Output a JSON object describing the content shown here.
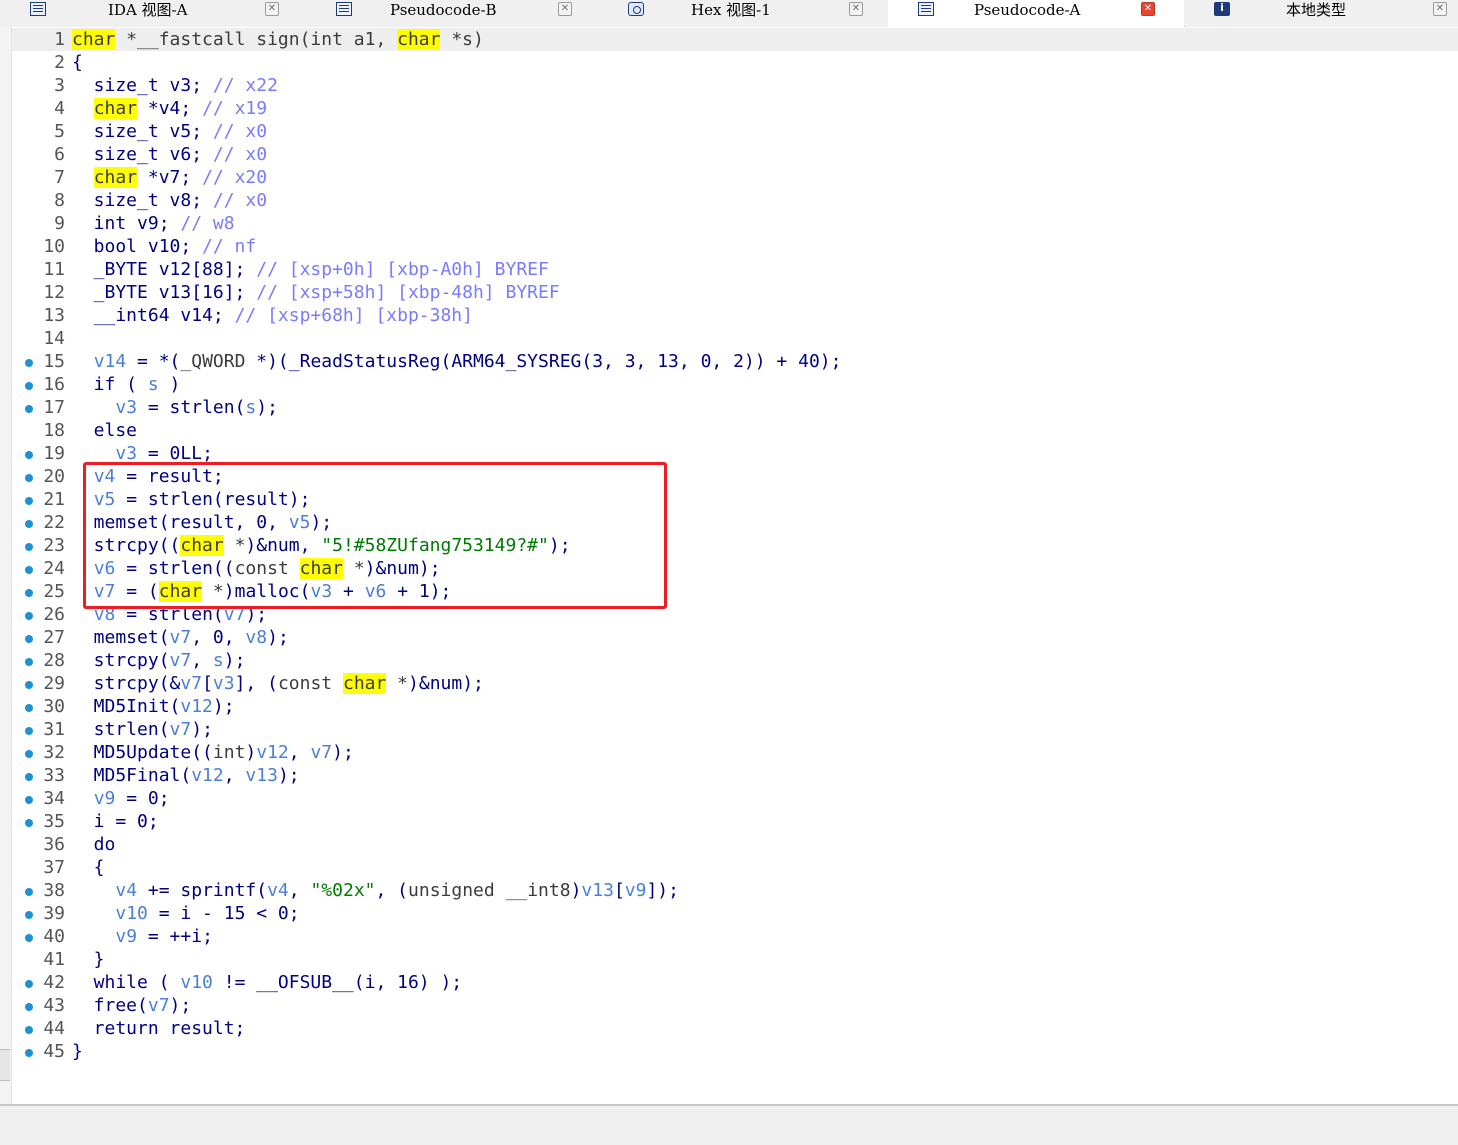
{
  "tabs": [
    {
      "label": "IDA 视图-A",
      "icon": "document-icon",
      "active": false
    },
    {
      "label": "Pseudocode-B",
      "icon": "document-icon",
      "active": false
    },
    {
      "label": "Hex 视图-1",
      "icon": "hex-view-icon",
      "active": false
    },
    {
      "label": "Pseudocode-A",
      "icon": "document-icon",
      "active": true
    },
    {
      "label": "本地类型",
      "icon": "info-icon",
      "active": false
    }
  ],
  "colors": {
    "keyword_highlight": "#ffff00",
    "variable": "#4a7fd6",
    "string": "#007a00",
    "comment": "#7a7aff",
    "breakpoint_dot": "#1e90d8",
    "annotation_box": "#ee1c24"
  },
  "annotation": {
    "shape": "red rectangle",
    "first_line": 20,
    "last_line": 25
  },
  "code": [
    {
      "n": "1",
      "dot": false,
      "tokens": [
        [
          "hl",
          "char"
        ],
        [
          "kw",
          " *__fastcall sign(int a1, "
        ],
        [
          "hl",
          "char"
        ],
        [
          "kw",
          " *s)"
        ]
      ]
    },
    {
      "n": "2",
      "dot": false,
      "tokens": [
        [
          "p",
          "{"
        ]
      ]
    },
    {
      "n": "3",
      "dot": false,
      "tokens": [
        [
          "p",
          "  size_t v3; "
        ],
        [
          "cm",
          "// x22"
        ]
      ]
    },
    {
      "n": "4",
      "dot": false,
      "tokens": [
        [
          "p",
          "  "
        ],
        [
          "hl",
          "char"
        ],
        [
          "p",
          " *v4; "
        ],
        [
          "cm",
          "// x19"
        ]
      ]
    },
    {
      "n": "5",
      "dot": false,
      "tokens": [
        [
          "p",
          "  size_t v5; "
        ],
        [
          "cm",
          "// x0"
        ]
      ]
    },
    {
      "n": "6",
      "dot": false,
      "tokens": [
        [
          "p",
          "  size_t v6; "
        ],
        [
          "cm",
          "// x0"
        ]
      ]
    },
    {
      "n": "7",
      "dot": false,
      "tokens": [
        [
          "p",
          "  "
        ],
        [
          "hl",
          "char"
        ],
        [
          "p",
          " *v7; "
        ],
        [
          "cm",
          "// x20"
        ]
      ]
    },
    {
      "n": "8",
      "dot": false,
      "tokens": [
        [
          "p",
          "  size_t v8; "
        ],
        [
          "cm",
          "// x0"
        ]
      ]
    },
    {
      "n": "9",
      "dot": false,
      "tokens": [
        [
          "p",
          "  int v9; "
        ],
        [
          "cm",
          "// w8"
        ]
      ]
    },
    {
      "n": "10",
      "dot": false,
      "tokens": [
        [
          "p",
          "  bool v10; "
        ],
        [
          "cm",
          "// nf"
        ]
      ]
    },
    {
      "n": "11",
      "dot": false,
      "tokens": [
        [
          "p",
          "  _BYTE v12[88]; "
        ],
        [
          "cm",
          "// [xsp+0h] [xbp-A0h] BYREF"
        ]
      ]
    },
    {
      "n": "12",
      "dot": false,
      "tokens": [
        [
          "p",
          "  _BYTE v13[16]; "
        ],
        [
          "cm",
          "// [xsp+58h] [xbp-48h] BYREF"
        ]
      ]
    },
    {
      "n": "13",
      "dot": false,
      "tokens": [
        [
          "p",
          "  __int64 v14; "
        ],
        [
          "cm",
          "// [xsp+68h] [xbp-38h]"
        ]
      ]
    },
    {
      "n": "14",
      "dot": false,
      "tokens": []
    },
    {
      "n": "15",
      "dot": true,
      "tokens": [
        [
          "p",
          "  "
        ],
        [
          "var",
          "v14"
        ],
        [
          "p",
          " = *("
        ],
        [
          "kw",
          "_QWORD"
        ],
        [
          "p",
          " *)(_ReadStatusReg(ARM64_SYSREG(3, 3, 13, 0, 2)) + 40);"
        ]
      ]
    },
    {
      "n": "16",
      "dot": true,
      "tokens": [
        [
          "p",
          "  if ( "
        ],
        [
          "var",
          "s"
        ],
        [
          "p",
          " )"
        ]
      ]
    },
    {
      "n": "17",
      "dot": true,
      "tokens": [
        [
          "p",
          "    "
        ],
        [
          "var",
          "v3"
        ],
        [
          "p",
          " = strlen("
        ],
        [
          "var",
          "s"
        ],
        [
          "p",
          ");"
        ]
      ]
    },
    {
      "n": "18",
      "dot": false,
      "tokens": [
        [
          "p",
          "  else"
        ]
      ]
    },
    {
      "n": "19",
      "dot": true,
      "tokens": [
        [
          "p",
          "    "
        ],
        [
          "var",
          "v3"
        ],
        [
          "p",
          " = 0LL;"
        ]
      ]
    },
    {
      "n": "20",
      "dot": true,
      "tokens": [
        [
          "p",
          "  "
        ],
        [
          "var",
          "v4"
        ],
        [
          "p",
          " = result;"
        ]
      ]
    },
    {
      "n": "21",
      "dot": true,
      "tokens": [
        [
          "p",
          "  "
        ],
        [
          "var",
          "v5"
        ],
        [
          "p",
          " = strlen(result);"
        ]
      ]
    },
    {
      "n": "22",
      "dot": true,
      "tokens": [
        [
          "p",
          "  memset(result, 0, "
        ],
        [
          "var",
          "v5"
        ],
        [
          "p",
          ");"
        ]
      ]
    },
    {
      "n": "23",
      "dot": true,
      "tokens": [
        [
          "p",
          "  strcpy(("
        ],
        [
          "hl",
          "char"
        ],
        [
          "kw",
          " *"
        ],
        [
          "p",
          ")&num, "
        ],
        [
          "str",
          "\"5!#58ZUfang753149?#\""
        ],
        [
          "p",
          ");"
        ]
      ]
    },
    {
      "n": "24",
      "dot": true,
      "tokens": [
        [
          "p",
          "  "
        ],
        [
          "var",
          "v6"
        ],
        [
          "p",
          " = strlen(("
        ],
        [
          "kw",
          "const "
        ],
        [
          "hl",
          "char"
        ],
        [
          "kw",
          " *"
        ],
        [
          "p",
          ")&num);"
        ]
      ]
    },
    {
      "n": "25",
      "dot": true,
      "tokens": [
        [
          "p",
          "  "
        ],
        [
          "var",
          "v7"
        ],
        [
          "p",
          " = ("
        ],
        [
          "hl",
          "char"
        ],
        [
          "kw",
          " *"
        ],
        [
          "p",
          ")malloc("
        ],
        [
          "var",
          "v3"
        ],
        [
          "p",
          " + "
        ],
        [
          "var",
          "v6"
        ],
        [
          "p",
          " + 1);"
        ]
      ]
    },
    {
      "n": "26",
      "dot": true,
      "tokens": [
        [
          "p",
          "  "
        ],
        [
          "var",
          "v8"
        ],
        [
          "p",
          " = strlen("
        ],
        [
          "var",
          "v7"
        ],
        [
          "p",
          ");"
        ]
      ]
    },
    {
      "n": "27",
      "dot": true,
      "tokens": [
        [
          "p",
          "  memset("
        ],
        [
          "var",
          "v7"
        ],
        [
          "p",
          ", 0, "
        ],
        [
          "var",
          "v8"
        ],
        [
          "p",
          ");"
        ]
      ]
    },
    {
      "n": "28",
      "dot": true,
      "tokens": [
        [
          "p",
          "  strcpy("
        ],
        [
          "var",
          "v7"
        ],
        [
          "p",
          ", "
        ],
        [
          "var",
          "s"
        ],
        [
          "p",
          ");"
        ]
      ]
    },
    {
      "n": "29",
      "dot": true,
      "tokens": [
        [
          "p",
          "  strcpy(&"
        ],
        [
          "var",
          "v7"
        ],
        [
          "p",
          "["
        ],
        [
          "var",
          "v3"
        ],
        [
          "p",
          "], ("
        ],
        [
          "kw",
          "const "
        ],
        [
          "hl",
          "char"
        ],
        [
          "kw",
          " *"
        ],
        [
          "p",
          ")&num);"
        ]
      ]
    },
    {
      "n": "30",
      "dot": true,
      "tokens": [
        [
          "p",
          "  MD5Init("
        ],
        [
          "var",
          "v12"
        ],
        [
          "p",
          ");"
        ]
      ]
    },
    {
      "n": "31",
      "dot": true,
      "tokens": [
        [
          "p",
          "  strlen("
        ],
        [
          "var",
          "v7"
        ],
        [
          "p",
          ");"
        ]
      ]
    },
    {
      "n": "32",
      "dot": true,
      "tokens": [
        [
          "p",
          "  MD5Update(("
        ],
        [
          "kw",
          "int"
        ],
        [
          "p",
          ")"
        ],
        [
          "var",
          "v12"
        ],
        [
          "p",
          ", "
        ],
        [
          "var",
          "v7"
        ],
        [
          "p",
          ");"
        ]
      ]
    },
    {
      "n": "33",
      "dot": true,
      "tokens": [
        [
          "p",
          "  MD5Final("
        ],
        [
          "var",
          "v12"
        ],
        [
          "p",
          ", "
        ],
        [
          "var",
          "v13"
        ],
        [
          "p",
          ");"
        ]
      ]
    },
    {
      "n": "34",
      "dot": true,
      "tokens": [
        [
          "p",
          "  "
        ],
        [
          "var",
          "v9"
        ],
        [
          "p",
          " = 0;"
        ]
      ]
    },
    {
      "n": "35",
      "dot": true,
      "tokens": [
        [
          "p",
          "  i = 0;"
        ]
      ]
    },
    {
      "n": "36",
      "dot": false,
      "tokens": [
        [
          "p",
          "  do"
        ]
      ]
    },
    {
      "n": "37",
      "dot": false,
      "tokens": [
        [
          "p",
          "  {"
        ]
      ]
    },
    {
      "n": "38",
      "dot": true,
      "tokens": [
        [
          "p",
          "    "
        ],
        [
          "var",
          "v4"
        ],
        [
          "p",
          " += sprintf("
        ],
        [
          "var",
          "v4"
        ],
        [
          "p",
          ", "
        ],
        [
          "str",
          "\"%02x\""
        ],
        [
          "p",
          ", ("
        ],
        [
          "kw",
          "unsigned __int8"
        ],
        [
          "p",
          ")"
        ],
        [
          "var",
          "v13"
        ],
        [
          "p",
          "["
        ],
        [
          "var",
          "v9"
        ],
        [
          "p",
          "]);"
        ]
      ]
    },
    {
      "n": "39",
      "dot": true,
      "tokens": [
        [
          "p",
          "    "
        ],
        [
          "var",
          "v10"
        ],
        [
          "p",
          " = i - 15 < 0;"
        ]
      ]
    },
    {
      "n": "40",
      "dot": true,
      "tokens": [
        [
          "p",
          "    "
        ],
        [
          "var",
          "v9"
        ],
        [
          "p",
          " = ++i;"
        ]
      ]
    },
    {
      "n": "41",
      "dot": false,
      "tokens": [
        [
          "p",
          "  }"
        ]
      ]
    },
    {
      "n": "42",
      "dot": true,
      "tokens": [
        [
          "p",
          "  while ( "
        ],
        [
          "var",
          "v10"
        ],
        [
          "p",
          " != __OFSUB__(i, 16) );"
        ]
      ]
    },
    {
      "n": "43",
      "dot": true,
      "tokens": [
        [
          "p",
          "  free("
        ],
        [
          "var",
          "v7"
        ],
        [
          "p",
          ");"
        ]
      ]
    },
    {
      "n": "44",
      "dot": true,
      "tokens": [
        [
          "p",
          "  return result;"
        ]
      ]
    },
    {
      "n": "45",
      "dot": true,
      "tokens": [
        [
          "p",
          "}"
        ]
      ]
    }
  ]
}
